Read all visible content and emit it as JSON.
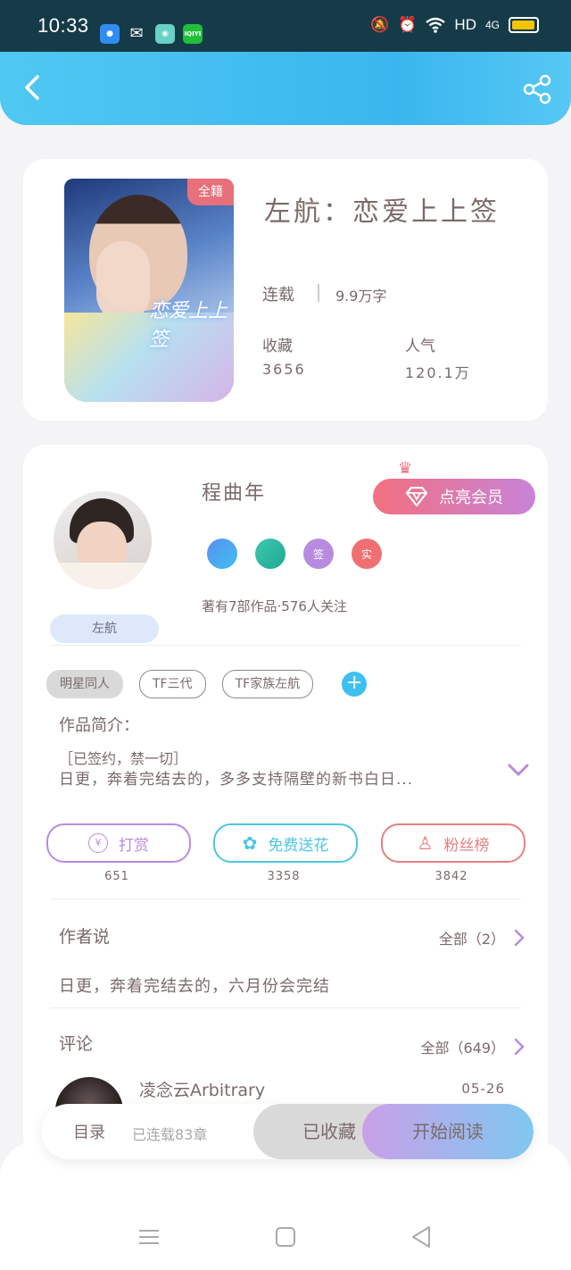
{
  "status_bar": {
    "time": "10:33",
    "apps": [
      "IQIYI"
    ],
    "network": "HD",
    "signal": "4G"
  },
  "book": {
    "cover_badge": "全籍",
    "cover_art_text": "恋爱上上签",
    "title": "左航：恋爱上上签",
    "serial_status": "连载",
    "word_count": "9.9万字",
    "favorites_label": "收藏",
    "favorites_value": "3656",
    "popularity_label": "人气",
    "popularity_value": "120.1万"
  },
  "author": {
    "name": "程曲年",
    "tag": "左航",
    "vip_button": "点亮会员",
    "badges": [
      "",
      "",
      "签",
      "实"
    ],
    "stats": "著有7部作品·576人关注"
  },
  "tags": [
    "明星同人",
    "TF三代",
    "TF家族左航"
  ],
  "intro": {
    "label": "作品简介：",
    "line1": "［已签约，禁一切］",
    "line2": "日更，奔着完结去的，多多支持隔壁的新书白日..."
  },
  "actions": [
    {
      "label": "打赏",
      "count": "651",
      "color": "#b98be0"
    },
    {
      "label": "免费送花",
      "count": "3358",
      "color": "#4cc6e0"
    },
    {
      "label": "粉丝榜",
      "count": "3842",
      "color": "#e77f7f"
    }
  ],
  "author_says": {
    "title": "作者说",
    "all": "全部（2）",
    "text": "日更，奔着完结去的，六月份会完结"
  },
  "comments": {
    "title": "评论",
    "all": "全部（649）",
    "first": {
      "name": "凌念云Arbitrary",
      "date": "05-26"
    }
  },
  "bottom_bar": {
    "toc": "目录",
    "chapter_status": "已连载83章",
    "collected": "已收藏",
    "read": "开始阅读"
  }
}
